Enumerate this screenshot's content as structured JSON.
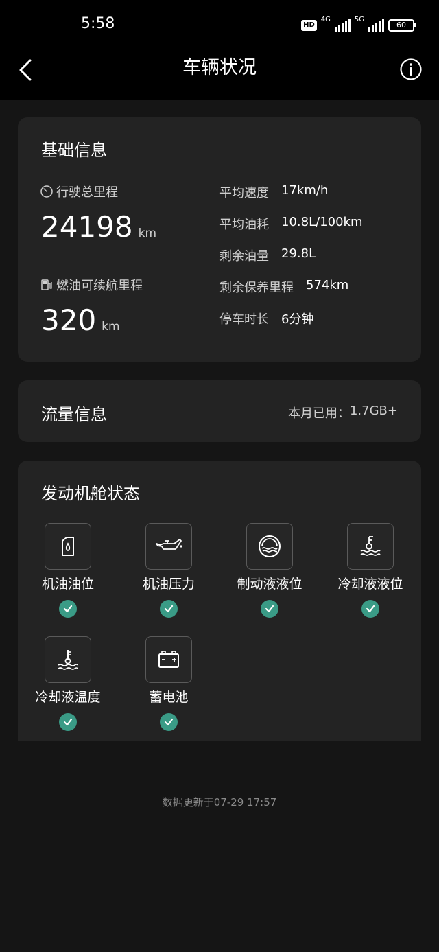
{
  "status_bar": {
    "time": "5:58",
    "hd_label": "HD",
    "network_1": "4G",
    "network_2": "5G",
    "battery_level": "60"
  },
  "nav": {
    "title": "车辆状况"
  },
  "basic_info": {
    "title": "基础信息",
    "total_mileage_label": "行驶总里程",
    "total_mileage_value": "24198",
    "total_mileage_unit": "km",
    "fuel_range_label": "燃油可续航里程",
    "fuel_range_value": "320",
    "fuel_range_unit": "km",
    "stats": [
      {
        "label": "平均速度",
        "value": "17km/h"
      },
      {
        "label": "平均油耗",
        "value": "10.8L/100km"
      },
      {
        "label": "剩余油量",
        "value": "29.8L"
      },
      {
        "label": "剩余保养里程",
        "value": "574km"
      },
      {
        "label": "停车时长",
        "value": "6分钟"
      }
    ]
  },
  "traffic_info": {
    "title": "流量信息",
    "usage_label": "本月已用：",
    "usage_value": "1.7GB+"
  },
  "engine_status": {
    "title": "发动机舱状态",
    "items": [
      {
        "label": "机油油位",
        "icon": "oil-level-icon",
        "status": "ok"
      },
      {
        "label": "机油压力",
        "icon": "oil-pressure-icon",
        "status": "ok"
      },
      {
        "label": "制动液液位",
        "icon": "brake-fluid-icon",
        "status": "ok"
      },
      {
        "label": "冷却液液位",
        "icon": "coolant-level-icon",
        "status": "ok"
      },
      {
        "label": "冷却液温度",
        "icon": "coolant-temperature-icon",
        "status": "ok"
      },
      {
        "label": "蓄电池",
        "icon": "battery-icon",
        "status": "ok"
      }
    ]
  },
  "footer": {
    "update_text": "数据更新于07-29 17:57"
  },
  "colors": {
    "background": "#151515",
    "card": "#232323",
    "check_ok": "#3a9b86"
  }
}
